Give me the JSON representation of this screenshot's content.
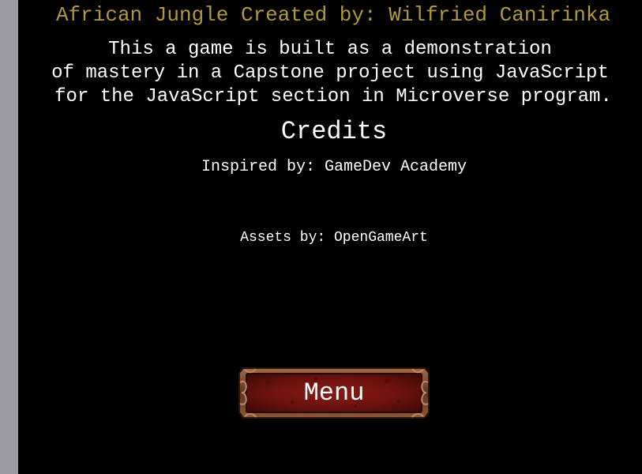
{
  "game": {
    "title": "African Jungle Created by: Wilfried Canirinka",
    "description_lines": [
      "This a game is built as a demonstration",
      "of mastery in a Capstone project using JavaScript",
      "for the JavaScript section in Microverse program."
    ],
    "credits_heading": "Credits",
    "inspired_by": "Inspired by: GameDev Academy",
    "assets_by": "Assets by: OpenGameArt",
    "menu_button_label": "Menu"
  },
  "colors": {
    "background": "#000000",
    "title": "#b3983a",
    "text": "#ffffff",
    "side_strip": "#9e9aa3",
    "button_fill": "#6e1410",
    "button_frame": "#7a4a2a"
  }
}
